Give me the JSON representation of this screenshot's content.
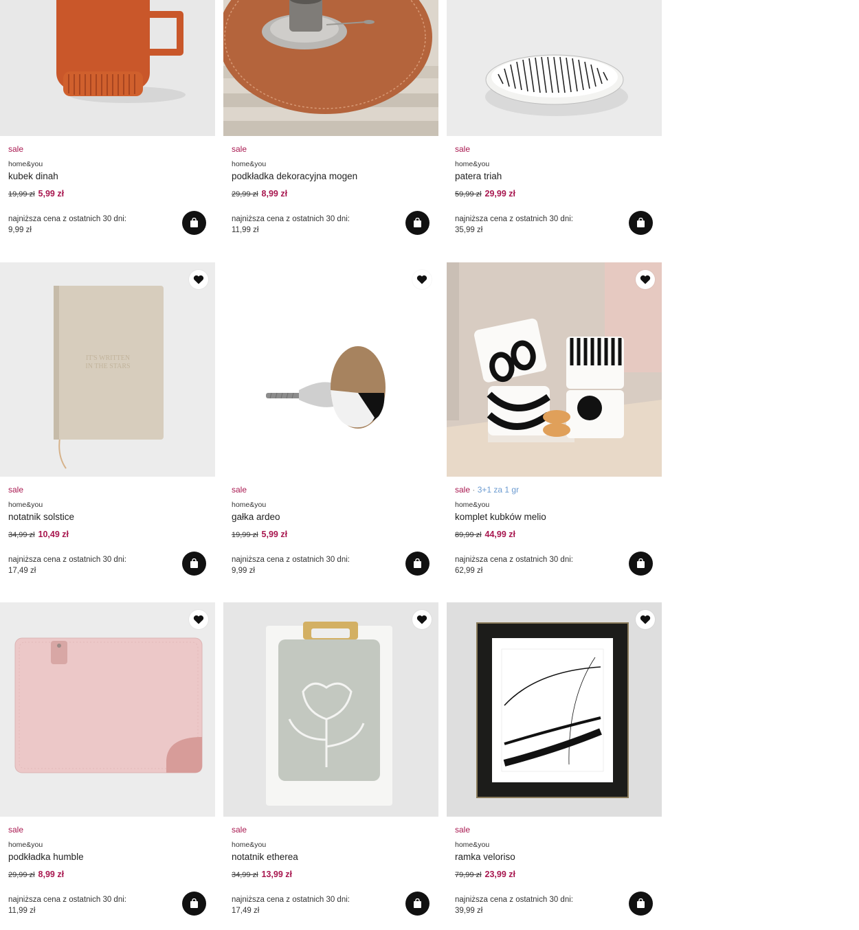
{
  "labels": {
    "sale": "sale",
    "lowest_price": "najniższa cena z ostatnich 30 dni:"
  },
  "icons": {
    "wishlist": "heart-icon",
    "add_to_cart": "shopping-bag-icon"
  },
  "colors": {
    "sale": "#a8174f",
    "promo": "#6a9ad0",
    "button": "#111111"
  },
  "products": [
    {
      "brand": "home&you",
      "name": "kubek dinah",
      "old_price": "19,99 zł",
      "new_price": "5,99 zł",
      "lowest_price": "9,99 zł",
      "promo": ""
    },
    {
      "brand": "home&you",
      "name": "podkładka dekoracyjna mogen",
      "old_price": "29,99 zł",
      "new_price": "8,99 zł",
      "lowest_price": "11,99 zł",
      "promo": ""
    },
    {
      "brand": "home&you",
      "name": "patera triah",
      "old_price": "59,99 zł",
      "new_price": "29,99 zł",
      "lowest_price": "35,99 zł",
      "promo": ""
    },
    {
      "brand": "home&you",
      "name": "notatnik solstice",
      "old_price": "34,99 zł",
      "new_price": "10,49 zł",
      "lowest_price": "17,49 zł",
      "promo": ""
    },
    {
      "brand": "home&you",
      "name": "gałka ardeo",
      "old_price": "19,99 zł",
      "new_price": "5,99 zł",
      "lowest_price": "9,99 zł",
      "promo": ""
    },
    {
      "brand": "home&you",
      "name": "komplet kubków melio",
      "old_price": "89,99 zł",
      "new_price": "44,99 zł",
      "lowest_price": "62,99 zł",
      "promo": "3+1 za 1 gr"
    },
    {
      "brand": "home&you",
      "name": "podkładka humble",
      "old_price": "29,99 zł",
      "new_price": "8,99 zł",
      "lowest_price": "11,99 zł",
      "promo": ""
    },
    {
      "brand": "home&you",
      "name": "notatnik etherea",
      "old_price": "34,99 zł",
      "new_price": "13,99 zł",
      "lowest_price": "17,49 zł",
      "promo": ""
    },
    {
      "brand": "home&you",
      "name": "ramka veloriso",
      "old_price": "79,99 zł",
      "new_price": "23,99 zł",
      "lowest_price": "39,99 zł",
      "promo": ""
    }
  ]
}
